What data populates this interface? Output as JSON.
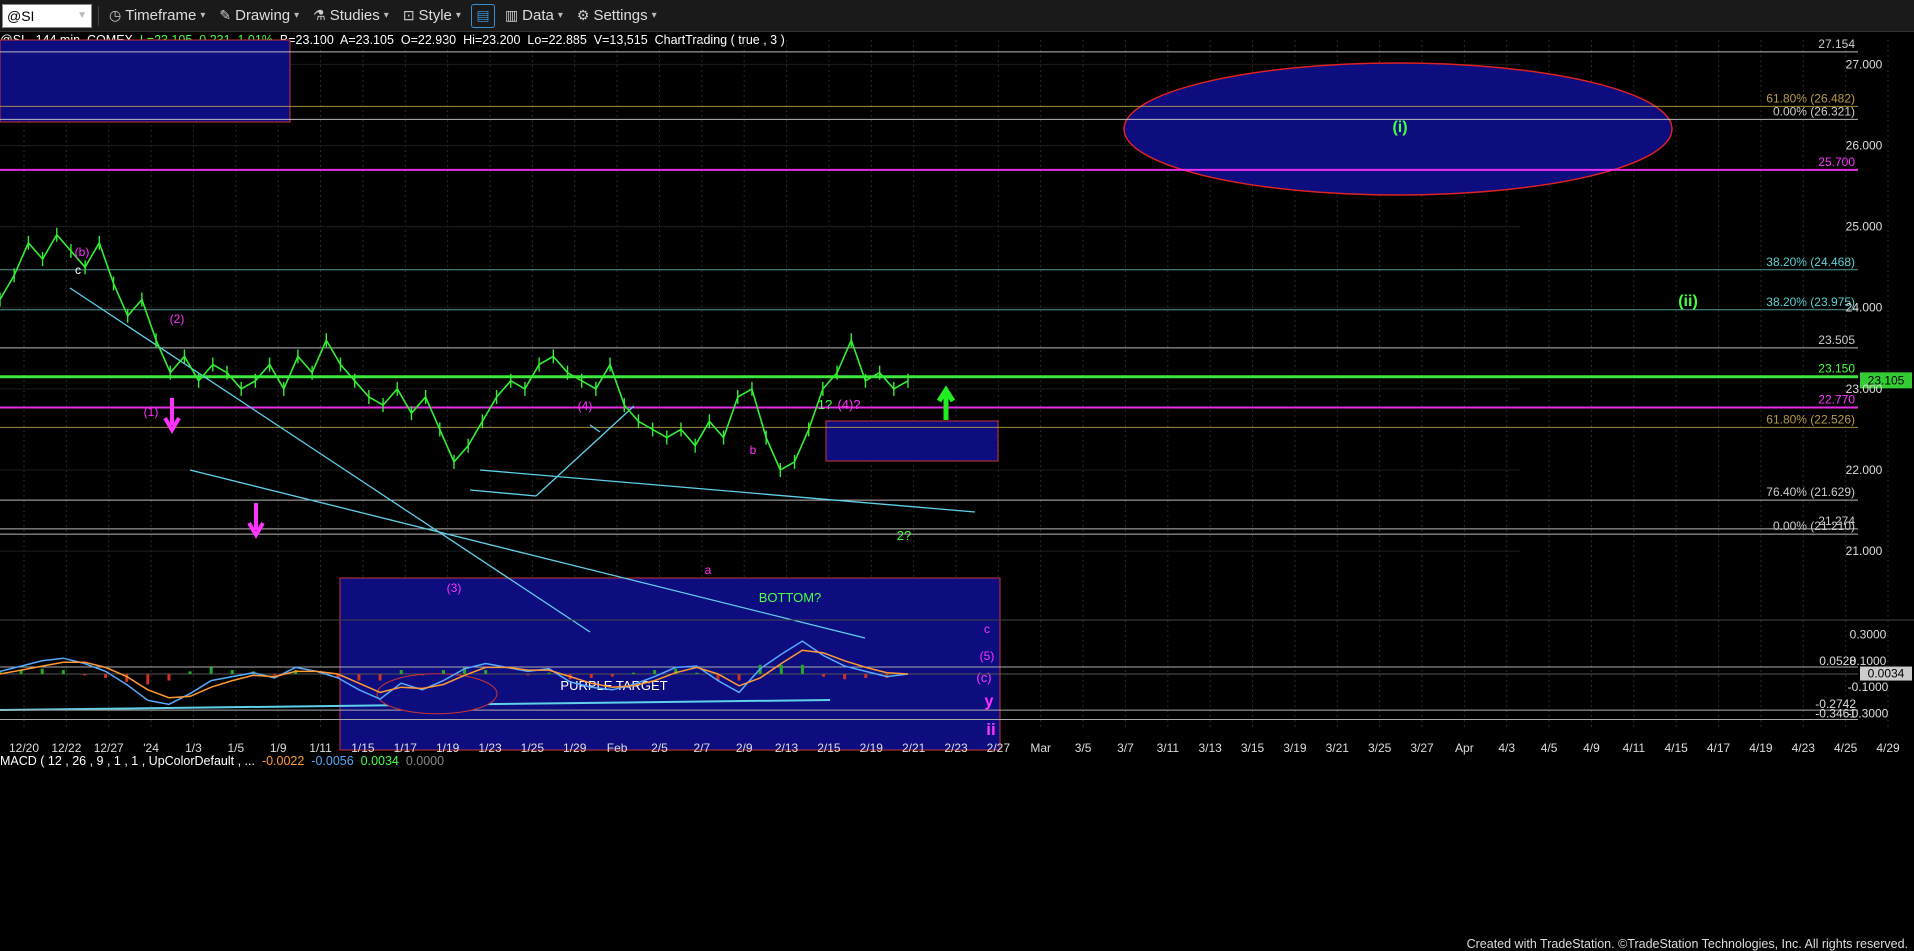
{
  "toolbar": {
    "symbol": "@SI",
    "items": [
      {
        "icon": "clock-icon",
        "label": "Timeframe"
      },
      {
        "icon": "pencil-icon",
        "label": "Drawing"
      },
      {
        "icon": "flask-icon",
        "label": "Studies"
      },
      {
        "icon": "style-icon",
        "label": "Style"
      },
      {
        "icon": "data-icon",
        "label": "Data"
      },
      {
        "icon": "gear-icon",
        "label": "Settings"
      }
    ]
  },
  "info": {
    "symbol": "@SI - 144 min",
    "exchange": "COMEX",
    "last": "L=23.105",
    "change": "0.231",
    "pct": "1.01%",
    "bid": "B=23.100",
    "ask": "A=23.105",
    "open": "O=22.930",
    "high": "Hi=23.200",
    "low": "Lo=22.885",
    "vol": "V=13,515",
    "study": "ChartTrading ( true , 3 )"
  },
  "macd_header": {
    "label": "MACD ( 12 , 26 , 9 , 1 , 1 , UpColorDefault , ...",
    "v1": "-0.0022",
    "v2": "-0.0056",
    "v3": "0.0034",
    "v4": "0.0000"
  },
  "colors": {
    "price": "#33ee33",
    "magenta": "#ff33ff",
    "green_line": "#44ff44",
    "box_fill": "#0d0d80",
    "trend": "#5fd0e8",
    "macd": "#55aaff",
    "signal": "#ff9933"
  },
  "chart_data": [
    {
      "type": "line",
      "title": "",
      "ylim": [
        20.25,
        27.3
      ],
      "y_ticks": [
        "27.000",
        "26.000",
        "25.000",
        "24.000",
        "23.000",
        "22.000",
        "21.000"
      ],
      "x_ticks": [
        "12/20",
        "12/22",
        "12/27",
        "'24",
        "1/3",
        "1/5",
        "1/9",
        "1/11",
        "1/15",
        "1/17",
        "1/19",
        "1/23",
        "1/25",
        "1/29",
        "Feb",
        "2/5",
        "2/7",
        "2/9",
        "2/13",
        "2/15",
        "2/19",
        "2/21",
        "2/23",
        "2/27",
        "Mar",
        "3/5",
        "3/7",
        "3/11",
        "3/13",
        "3/15",
        "3/19",
        "3/21",
        "3/25",
        "3/27",
        "Apr",
        "4/3",
        "4/5",
        "4/9",
        "4/11",
        "4/15",
        "4/17",
        "4/19",
        "4/23",
        "4/25",
        "4/29"
      ],
      "series": [
        {
          "values": [
            24.1,
            24.4,
            24.8,
            24.6,
            24.9,
            24.7,
            24.5,
            24.8,
            24.3,
            23.9,
            24.1,
            23.6,
            23.2,
            23.4,
            23.1,
            23.3,
            23.2,
            23.0,
            23.1,
            23.3,
            23.0,
            23.4,
            23.2,
            23.6,
            23.3,
            23.1,
            22.9,
            22.8,
            23.0,
            22.7,
            22.9,
            22.5,
            22.1,
            22.3,
            22.6,
            22.9,
            23.1,
            23.0,
            23.3,
            23.4,
            23.2,
            23.1,
            23.0,
            23.3,
            22.8,
            22.6,
            22.5,
            22.4,
            22.5,
            22.3,
            22.6,
            22.4,
            22.9,
            23.0,
            22.4,
            22.0,
            22.1,
            22.5,
            23.0,
            23.2,
            23.6,
            23.1,
            23.2,
            23.0,
            23.1
          ]
        }
      ],
      "price_levels": [
        {
          "label": "27.154",
          "value": 27.154,
          "color": "#cccccc"
        },
        {
          "label": "61.80% (26.482)",
          "value": 26.482,
          "color": "#b59a4a"
        },
        {
          "label": "0.00% (26.321)",
          "value": 26.321,
          "color": "#cccccc"
        },
        {
          "label": "25.700",
          "value": 25.7,
          "color": "#ff33ff"
        },
        {
          "label": "38.20% (24.468)",
          "value": 24.468,
          "color": "#5fa7a7"
        },
        {
          "label": "38.20% (23.975)",
          "value": 23.975,
          "color": "#5fa7a7"
        },
        {
          "label": "23.505",
          "value": 23.505,
          "color": "#cccccc"
        },
        {
          "label": "23.150",
          "value": 23.15,
          "color": "#44ff44"
        },
        {
          "label": "22.770",
          "value": 22.77,
          "color": "#ff33ff"
        },
        {
          "label": "61.80% (22.526)",
          "value": 22.526,
          "color": "#b59a4a"
        },
        {
          "label": "76.40% (21.629)",
          "value": 21.629,
          "color": "#cccccc"
        },
        {
          "label": "21.274",
          "value": 21.274,
          "color": "#cccccc"
        },
        {
          "label": "0.00% (21.210)",
          "value": 21.21,
          "color": "#cccccc"
        }
      ],
      "last_price": "23.105",
      "annotations": [
        {
          "text": "(b)",
          "color": "#ff33ff"
        },
        {
          "text": "c",
          "color": "#ffffff"
        },
        {
          "text": "(2)",
          "color": "#ff33ff"
        },
        {
          "text": "(1)",
          "color": "#ff33ff"
        },
        {
          "text": "(3)",
          "color": "#ff33ff"
        },
        {
          "text": "(4)",
          "color": "#ff33ff"
        },
        {
          "text": "b",
          "color": "#ff33ff"
        },
        {
          "text": "a",
          "color": "#ff33ff"
        },
        {
          "text": "1?",
          "color": "#44ff44"
        },
        {
          "text": "(4)?",
          "color": "#ff33ff"
        },
        {
          "text": "2?",
          "color": "#44ff44"
        },
        {
          "text": "BOTTOM?",
          "color": "#44ff44"
        },
        {
          "text": "PURPLE TARGET",
          "color": "#ffffff"
        },
        {
          "text": "c",
          "color": "#ff33ff"
        },
        {
          "text": "(5)",
          "color": "#ff33ff"
        },
        {
          "text": "(c)",
          "color": "#ff33ff"
        },
        {
          "text": "y",
          "color": "#ff33ff"
        },
        {
          "text": "ii",
          "color": "#ff33ff"
        },
        {
          "text": "(i)",
          "color": "#44ff44"
        },
        {
          "text": "(ii)",
          "color": "#44ff44"
        }
      ]
    },
    {
      "type": "line",
      "title": "MACD",
      "ylim": [
        -0.38,
        0.38
      ],
      "y_ticks": [
        "0.3000",
        "0.1000",
        "-0.1000",
        "-0.3000"
      ],
      "levels": [
        "0.0528",
        "-0.2742",
        "-0.3461"
      ],
      "last_value": "0.0034",
      "series": [
        {
          "name": "MACD",
          "values": [
            0.02,
            0.06,
            0.1,
            0.12,
            0.08,
            0.02,
            -0.08,
            -0.2,
            -0.23,
            -0.15,
            -0.05,
            -0.02,
            0.01,
            -0.03,
            0.05,
            0.02,
            -0.03,
            -0.12,
            -0.19,
            -0.07,
            -0.12,
            -0.05,
            0.04,
            0.08,
            0.05,
            0.02,
            0.04,
            -0.06,
            -0.1,
            -0.12,
            -0.08,
            -0.02,
            0.05,
            0.06,
            -0.05,
            -0.14,
            0.04,
            0.15,
            0.25,
            0.14,
            0.06,
            0.02,
            -0.02,
            0.0
          ]
        },
        {
          "name": "Signal",
          "values": [
            0.0,
            0.03,
            0.06,
            0.09,
            0.09,
            0.05,
            -0.02,
            -0.12,
            -0.18,
            -0.17,
            -0.1,
            -0.05,
            -0.01,
            -0.02,
            0.02,
            0.02,
            0.0,
            -0.07,
            -0.14,
            -0.1,
            -0.11,
            -0.08,
            -0.01,
            0.05,
            0.05,
            0.03,
            0.03,
            -0.02,
            -0.07,
            -0.1,
            -0.09,
            -0.05,
            0.01,
            0.05,
            0.0,
            -0.09,
            -0.03,
            0.08,
            0.18,
            0.16,
            0.1,
            0.05,
            0.01,
            0.0
          ]
        }
      ]
    }
  ],
  "footer": "Created with TradeStation. ©TradeStation Technologies, Inc. All rights reserved."
}
